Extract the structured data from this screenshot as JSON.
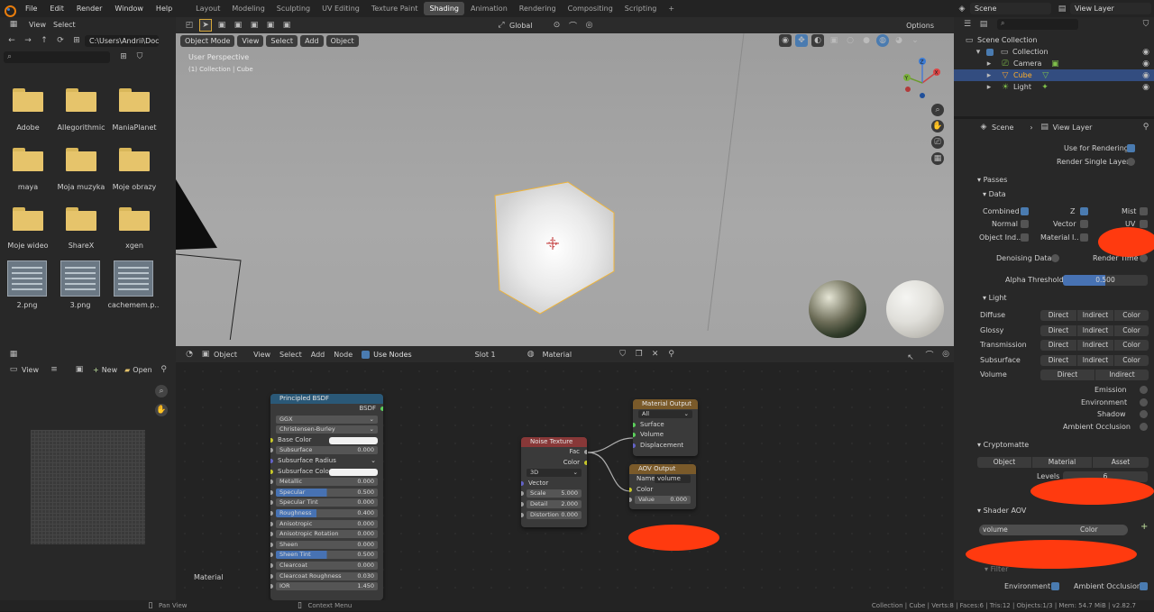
{
  "menu": [
    "File",
    "Edit",
    "Render",
    "Window",
    "Help"
  ],
  "workspaces": [
    {
      "label": "Layout"
    },
    {
      "label": "Modeling"
    },
    {
      "label": "Sculpting"
    },
    {
      "label": "UV Editing"
    },
    {
      "label": "Texture Paint"
    },
    {
      "label": "Shading"
    },
    {
      "label": "Animation"
    },
    {
      "label": "Rendering"
    },
    {
      "label": "Compositing"
    },
    {
      "label": "Scripting"
    }
  ],
  "active_workspace": "Shading",
  "scene_field": "Scene",
  "viewlayer_field": "View Layer",
  "filebrowser": {
    "view": "View",
    "select": "Select",
    "path": "C:\\Users\\Andrii\\Docu...",
    "items": [
      {
        "name": "Adobe",
        "type": "folder"
      },
      {
        "name": "Allegorithmic",
        "type": "folder"
      },
      {
        "name": "ManiaPlanet",
        "type": "folder"
      },
      {
        "name": "maya",
        "type": "folder"
      },
      {
        "name": "Moja muzyka",
        "type": "folder"
      },
      {
        "name": "Moje obrazy",
        "type": "folder"
      },
      {
        "name": "Moje wideo",
        "type": "folder"
      },
      {
        "name": "ShareX",
        "type": "folder"
      },
      {
        "name": "xgen",
        "type": "folder"
      },
      {
        "name": "2.png",
        "type": "image"
      },
      {
        "name": "3.png",
        "type": "image"
      },
      {
        "name": "cachemem.p..",
        "type": "image"
      }
    ]
  },
  "viewport": {
    "transform": "Global",
    "options": "Options",
    "mode": "Object Mode",
    "menus": [
      "View",
      "Select",
      "Add",
      "Object"
    ],
    "overlay_title": "User Perspective",
    "overlay_sub": "(1) Collection | Cube",
    "axes": {
      "x": "X",
      "y": "Y",
      "z": "Z"
    }
  },
  "node_editor": {
    "editor": "Object",
    "menus": [
      "View",
      "Select",
      "Add",
      "Node"
    ],
    "use_nodes": "Use Nodes",
    "slot": "Slot 1",
    "material": "Material",
    "frame_label": "Material",
    "bsdf": {
      "title": "Principled BSDF",
      "out": "BSDF",
      "dist": "GGX",
      "sss": "Christensen-Burley",
      "rows": [
        {
          "label": "Base Color",
          "value": ""
        },
        {
          "label": "Subsurface",
          "value": "0.000"
        },
        {
          "label": "Subsurface Radius",
          "value": ""
        },
        {
          "label": "Subsurface Color",
          "value": ""
        },
        {
          "label": "Metallic",
          "value": "0.000"
        },
        {
          "label": "Specular",
          "value": "0.500"
        },
        {
          "label": "Specular Tint",
          "value": "0.000"
        },
        {
          "label": "Roughness",
          "value": "0.400"
        },
        {
          "label": "Anisotropic",
          "value": "0.000"
        },
        {
          "label": "Anisotropic Rotation",
          "value": "0.000"
        },
        {
          "label": "Sheen",
          "value": "0.000"
        },
        {
          "label": "Sheen Tint",
          "value": "0.500"
        },
        {
          "label": "Clearcoat",
          "value": "0.000"
        },
        {
          "label": "Clearcoat Roughness",
          "value": "0.030"
        },
        {
          "label": "IOR",
          "value": "1.450"
        }
      ]
    },
    "noise": {
      "title": "Noise Texture",
      "fac": "Fac",
      "color": "Color",
      "dim": "3D",
      "vector": "Vector",
      "rows": [
        {
          "label": "Scale",
          "value": "5.000"
        },
        {
          "label": "Detail",
          "value": "2.000"
        },
        {
          "label": "Distortion",
          "value": "0.000"
        }
      ]
    },
    "matout": {
      "title": "Material Output",
      "target": "All",
      "sockets": [
        "Surface",
        "Volume",
        "Displacement"
      ]
    },
    "aov": {
      "title": "AOV Output",
      "name_label": "Name",
      "name_value": "volume",
      "color": "Color",
      "value_label": "Value",
      "value": "0.000"
    }
  },
  "image_editor": {
    "view": "View",
    "new": "New",
    "open": "Open"
  },
  "outliner": {
    "root": "Scene Collection",
    "items": [
      {
        "label": "Collection"
      },
      {
        "label": "Camera"
      },
      {
        "label": "Cube"
      },
      {
        "label": "Light"
      }
    ]
  },
  "properties": {
    "scene": "Scene",
    "view_layer": "View Layer",
    "use_for_rendering": "Use for Rendering",
    "render_single_layer": "Render Single Layer",
    "passes": "Passes",
    "data": "Data",
    "data_items": [
      {
        "label": "Combined",
        "on": true
      },
      {
        "label": "Z",
        "on": true
      },
      {
        "label": "Mist",
        "on": false
      },
      {
        "label": "Normal",
        "on": false
      },
      {
        "label": "Vector",
        "on": false
      },
      {
        "label": "UV",
        "on": false
      },
      {
        "label": "Object Ind..",
        "on": false
      },
      {
        "label": "Material I..",
        "on": false
      }
    ],
    "denoising_data": "Denoising Data",
    "render_time": "Render Time",
    "alpha_threshold_label": "Alpha Threshold",
    "alpha_threshold": "0.500",
    "light": "Light",
    "light_rows": [
      {
        "label": "Diffuse",
        "b": [
          "Direct",
          "Indirect",
          "Color"
        ]
      },
      {
        "label": "Glossy",
        "b": [
          "Direct",
          "Indirect",
          "Color"
        ]
      },
      {
        "label": "Transmission",
        "b": [
          "Direct",
          "Indirect",
          "Color"
        ]
      },
      {
        "label": "Subsurface",
        "b": [
          "Direct",
          "Indirect",
          "Color"
        ]
      },
      {
        "label": "Volume",
        "b": [
          "Direct",
          "Indirect"
        ]
      }
    ],
    "light_checks": [
      "Emission",
      "Environment",
      "Shadow",
      "Ambient Occlusion"
    ],
    "cryptomatte": "Cryptomatte",
    "crypto_buttons": [
      "Object",
      "Material",
      "Asset"
    ],
    "levels_label": "Levels",
    "levels": "6",
    "shader_aov": "Shader AOV",
    "aov_name": "volume",
    "aov_type": "Color",
    "filter": "Filter",
    "filter_items": [
      "Environment",
      "Ambient Occlusion"
    ]
  },
  "status": {
    "left": "Pan View",
    "mid": "Context Menu",
    "right": "Collection | Cube | Verts:8 | Faces:6 | Tris:12 | Objects:1/3 | Mem: 54.7 MiB | v2.82.7"
  }
}
